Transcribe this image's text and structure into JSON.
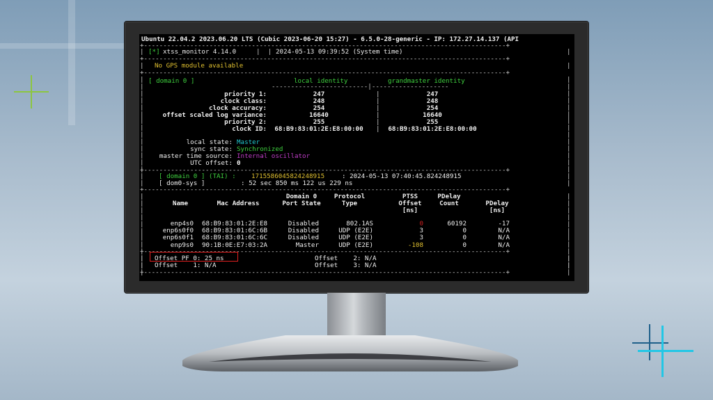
{
  "terminal": {
    "header": "Ubuntu 22.04.2 2023.06.20 LTS (Cubic 2023-06-20 15:27) - 6.5.0-28-generic - IP: 172.27.14.137 (API",
    "app_marker": "[*]",
    "app_name": "xtss_monitor 4.14.0",
    "datetime": "2024-05-13 09:39:52 (System time)",
    "gps_status": "No GPS module available",
    "domain_label": "[ domain 0 ]",
    "col_local": "local identity",
    "col_grandmaster": "grandmaster identity",
    "identity_rows": [
      {
        "label": "priority 1:",
        "local": "247",
        "gm": "247"
      },
      {
        "label": "clock class:",
        "local": "248",
        "gm": "248"
      },
      {
        "label": "clock accuracy:",
        "local": "254",
        "gm": "254"
      },
      {
        "label": "offset scaled log variance:",
        "local": "16640",
        "gm": "16640"
      },
      {
        "label": "priority 2:",
        "local": "255",
        "gm": "255"
      },
      {
        "label": "clock ID:",
        "local": "68:B9:83:01:2E:E8:00:00",
        "gm": "68:B9:83:01:2E:E8:00:00"
      }
    ],
    "state": {
      "local_state_label": "local state:",
      "local_state": "Master",
      "sync_state_label": "sync state:",
      "sync_state": "Synchronized",
      "time_source_label": "master time source:",
      "time_source": "Internal oscillator",
      "utc_offset_label": "UTC offset:",
      "utc_offset": "0"
    },
    "tai": {
      "label": "[ domain 0 ] (TAI) :",
      "value": "1715586045824248915",
      "date": ": 2024-05-13 07:40:45.824248915",
      "sys_label": "[ dom0-sys ]",
      "sys_value": ": 52 sec 850 ms 122 us 229 ns"
    },
    "port_table": {
      "headers": [
        [
          "",
          "Name"
        ],
        [
          "",
          "Mac Address"
        ],
        [
          "Domain 0",
          "Port State"
        ],
        [
          "Protocol",
          "Type"
        ],
        [
          "PTSS",
          "Offset",
          "[ns]"
        ],
        [
          "PDelay",
          "Count"
        ],
        [
          "",
          "PDelay",
          "[ns]"
        ]
      ],
      "rows": [
        {
          "name": "enp4s0",
          "mac": "68:B9:83:01:2E:E8",
          "state": "Disabled",
          "proto": "802.1AS",
          "offset": "0",
          "count": "60192",
          "pdelay": "-17"
        },
        {
          "name": "enp6s0f0",
          "mac": "68:B9:83:01:6C:6B",
          "state": "Disabled",
          "proto": "UDP (E2E)",
          "offset": "3",
          "count": "0",
          "pdelay": "N/A"
        },
        {
          "name": "enp6s0f1",
          "mac": "68:B9:83:01:6C:6C",
          "state": "Disabled",
          "proto": "UDP (E2E)",
          "offset": "3",
          "count": "0",
          "pdelay": "N/A"
        },
        {
          "name": "enp9s0",
          "mac": "90:1B:0E:E7:03:2A",
          "state": "Master",
          "proto": "UDP (E2E)",
          "offset": "-108",
          "count": "0",
          "pdelay": "N/A"
        }
      ]
    },
    "offsets": [
      "Offset PF 0: 25 ns",
      "Offset    1: N/A",
      "Offset    2: N/A",
      "Offset    3: N/A"
    ]
  },
  "colors": {
    "green": "#3fd13f",
    "yellow": "#e0c030",
    "cyan": "#22c8d0",
    "magenta": "#c03ec8",
    "red": "#d02020",
    "highlight_box": "#e02020"
  }
}
